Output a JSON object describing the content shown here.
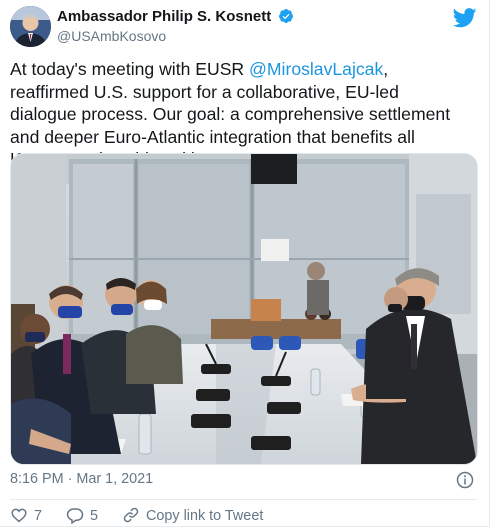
{
  "author": {
    "display_name": "Ambassador Philip S. Kosnett",
    "handle": "@USAmbKosovo"
  },
  "tweet": {
    "text_before": "At today's meeting with EUSR ",
    "mention": "@MiroslavLajcak",
    "text_after": ", reaffirmed U.S. support for a collaborative, EU-led dialogue process. Our goal: a comprehensive settlement and deeper Euro-Atlantic integration that benefits all Kosovo and Serbian citizens."
  },
  "meta": {
    "timestamp": "8:16 PM · Mar 1, 2021"
  },
  "actions": {
    "likes": "7",
    "replies": "5",
    "copy_link_label": "Copy link to Tweet"
  },
  "colors": {
    "brand": "#1da1f2",
    "mention": "#1b95e0",
    "muted": "#657786",
    "like": "#e0245e"
  },
  "icons": [
    "verified-badge-icon",
    "twitter-bird-icon",
    "info-icon",
    "heart-icon",
    "reply-bubble-icon",
    "link-icon"
  ]
}
